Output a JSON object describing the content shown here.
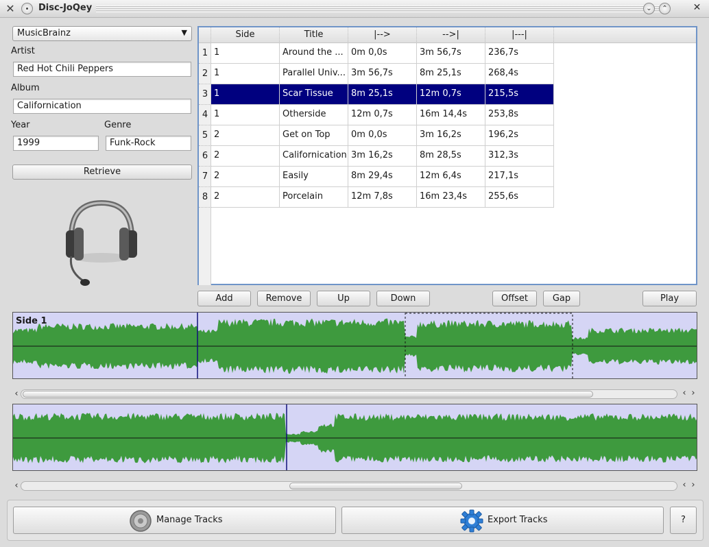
{
  "window": {
    "title": "Disc-JoQey"
  },
  "left": {
    "source": "MusicBrainz",
    "artist_label": "Artist",
    "artist": "Red Hot Chili Peppers",
    "album_label": "Album",
    "album": "Californication",
    "year_label": "Year",
    "year": "1999",
    "genre_label": "Genre",
    "genre": "Funk-Rock",
    "retrieve": "Retrieve"
  },
  "table": {
    "columns": [
      "Side",
      "Title",
      "|-->",
      "-->|",
      "|---|"
    ],
    "rows": [
      {
        "num": "1",
        "side": "1",
        "title": "Around the ...",
        "start": "0m 0,0s",
        "end": "3m 56,7s",
        "length": "236,7s"
      },
      {
        "num": "2",
        "side": "1",
        "title": "Parallel Univ...",
        "start": "3m 56,7s",
        "end": "8m 25,1s",
        "length": "268,4s"
      },
      {
        "num": "3",
        "side": "1",
        "title": "Scar Tissue",
        "start": "8m 25,1s",
        "end": "12m 0,7s",
        "length": "215,5s"
      },
      {
        "num": "4",
        "side": "1",
        "title": "Otherside",
        "start": "12m 0,7s",
        "end": "16m 14,4s",
        "length": "253,8s"
      },
      {
        "num": "5",
        "side": "2",
        "title": "Get on Top",
        "start": "0m 0,0s",
        "end": "3m 16,2s",
        "length": "196,2s"
      },
      {
        "num": "6",
        "side": "2",
        "title": "Californication",
        "start": "3m 16,2s",
        "end": "8m 28,5s",
        "length": "312,3s"
      },
      {
        "num": "7",
        "side": "2",
        "title": "Easily",
        "start": "8m 29,4s",
        "end": "12m 6,4s",
        "length": "217,1s"
      },
      {
        "num": "8",
        "side": "2",
        "title": "Porcelain",
        "start": "12m 7,8s",
        "end": "16m 23,4s",
        "length": "255,6s"
      }
    ],
    "selected_row": 3
  },
  "actions": {
    "add": "Add",
    "remove": "Remove",
    "up": "Up",
    "down": "Down",
    "offset": "Offset",
    "gap": "Gap",
    "play": "Play"
  },
  "waveform": {
    "side_label": "Side 1",
    "wave_color": "#3e9a3e",
    "bg_color": "#d5d5f5"
  },
  "bottom": {
    "manage": "Manage Tracks",
    "export": "Export Tracks",
    "help": "?"
  },
  "icons": [
    "app-x-icon",
    "window-menu-icon",
    "minimize-icon",
    "maximize-icon",
    "close-icon",
    "chevron-down-icon",
    "headset-icon",
    "speaker-icon",
    "gear-icon",
    "scroll-left-icon",
    "scroll-right-icon"
  ]
}
